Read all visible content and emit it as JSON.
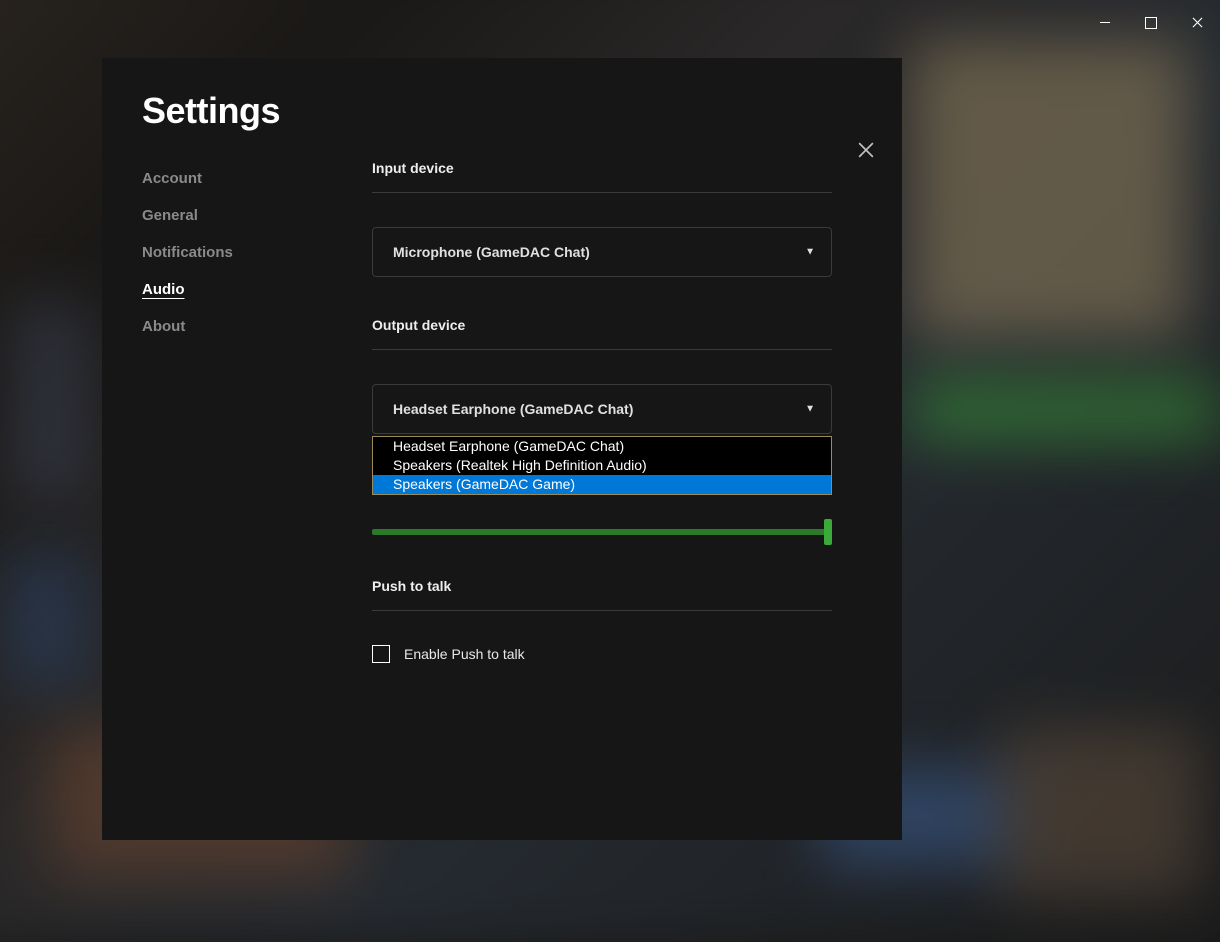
{
  "window": {
    "title": "Settings"
  },
  "sidebar": {
    "items": [
      {
        "label": "Account",
        "active": false
      },
      {
        "label": "General",
        "active": false
      },
      {
        "label": "Notifications",
        "active": false
      },
      {
        "label": "Audio",
        "active": true
      },
      {
        "label": "About",
        "active": false
      }
    ]
  },
  "content": {
    "input_device": {
      "label": "Input device",
      "selected": "Microphone (GameDAC Chat)"
    },
    "output_device": {
      "label": "Output device",
      "selected": "Headset Earphone (GameDAC Chat)",
      "options": [
        "Headset Earphone (GameDAC Chat)",
        "Speakers (Realtek High Definition Audio)",
        "Speakers (GameDAC Game)"
      ],
      "highlighted_index": 2
    },
    "volume": {
      "value": 100
    },
    "push_to_talk": {
      "label": "Push to talk",
      "checkbox_label": "Enable Push to talk",
      "enabled": false
    }
  },
  "colors": {
    "accent_green": "#3aaa3a",
    "highlight_blue": "#0078d7",
    "dropdown_border": "#9a8a5a"
  }
}
